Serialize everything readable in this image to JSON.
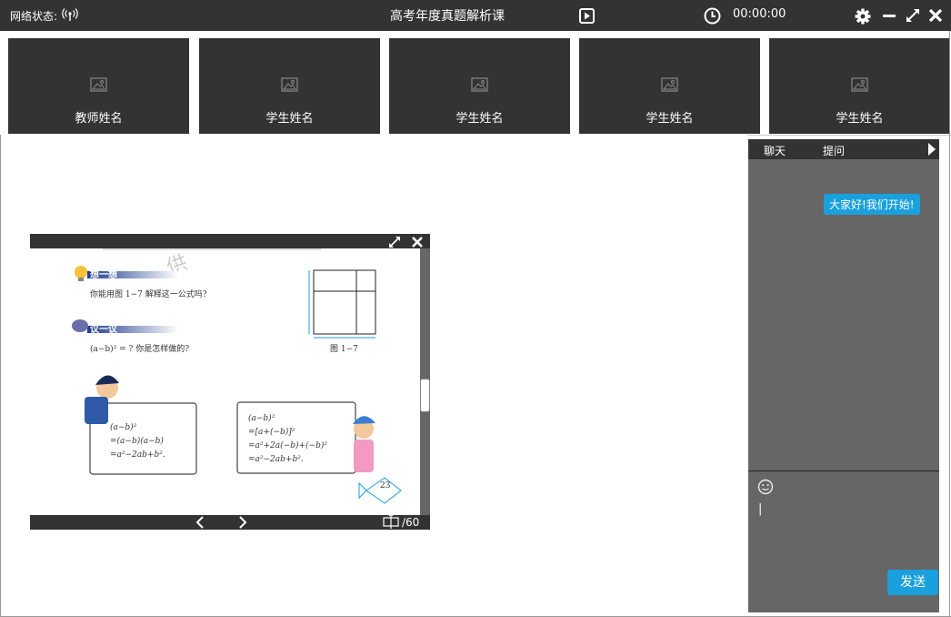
{
  "titlebar": {
    "network_label": "网络状态:",
    "title": "高考年度真题解析课",
    "timer": "00:00:00"
  },
  "videos": [
    {
      "name": "教师姓名"
    },
    {
      "name": "学生姓名"
    },
    {
      "name": "学生姓名"
    },
    {
      "name": "学生姓名"
    },
    {
      "name": "学生姓名"
    }
  ],
  "document": {
    "page_indicator": "/60",
    "think_label": "想一想",
    "think_text": "你能用图 1−7 解释这一公式吗?",
    "discuss_label": "议一议",
    "discuss_text": "(a−b)² = ? 你是怎样做的?",
    "figure_caption": "图 1−7",
    "board1": [
      "(a−b)²",
      "=(a−b)(a−b)",
      "=a²−2ab+b²."
    ],
    "board2": [
      "(a−b)²",
      "=[a+(−b)]²",
      "=a²+2a(−b)+(−b)²",
      "=a²−2ab+b²."
    ],
    "page_number": "23"
  },
  "chat": {
    "tab_chat": "聊天",
    "tab_question": "提问",
    "message": "大家好!我们开始!",
    "input_value": "|",
    "send_label": "发送"
  }
}
